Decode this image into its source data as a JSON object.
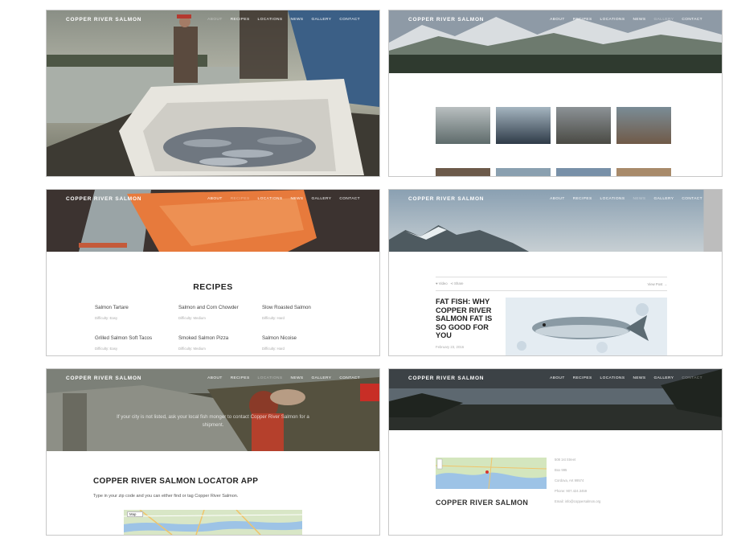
{
  "brand": "COPPER RIVER SALMON",
  "nav": [
    "ABOUT",
    "RECIPES",
    "LOCATIONS",
    "NEWS",
    "GALLERY",
    "CONTACT"
  ],
  "recipes": {
    "title": "RECIPES",
    "items": [
      {
        "name": "Salmon Tartare",
        "difficulty": "Difficulty: Easy"
      },
      {
        "name": "Salmon and Corn Chowder",
        "difficulty": "Difficulty: Medium"
      },
      {
        "name": "Slow Roasted Salmon",
        "difficulty": "Difficulty: Hard"
      },
      {
        "name": "Grilled Salmon Soft Tacos",
        "difficulty": "Difficulty: Easy"
      },
      {
        "name": "Smoked Salmon Pizza",
        "difficulty": "Difficulty: Medium"
      },
      {
        "name": "Salmon Nicoise",
        "difficulty": "Difficulty: Hard"
      }
    ]
  },
  "news": {
    "like": "♥ Video",
    "share": "⋖ Share",
    "view_post": "View Post →",
    "title": "FAT FISH: WHY COPPER RIVER SALMON FAT IS SO GOOD FOR YOU",
    "date": "February 23, 2016"
  },
  "locator": {
    "intro": "If your city is not listed, ask your local fish monger to contact Copper River Salmon for a shipment.",
    "title": "COPPER RIVER SALMON LOCATOR APP",
    "subtitle": "Type in your zip code and you can either find or tag Copper River Salmon.",
    "map_mode": "Map"
  },
  "contact": {
    "name": "COPPER RIVER SALMON",
    "address_lines": [
      "508 1st Street",
      "Box 995",
      "Cordova, AK 99574",
      "Phone: 907.424.3459",
      "Email: info@coppersalmon.org"
    ]
  },
  "colors": {
    "accent_salmon": "#e77a3c",
    "map_green": "#cfe3b8",
    "water_blue": "#9dc3e6"
  }
}
